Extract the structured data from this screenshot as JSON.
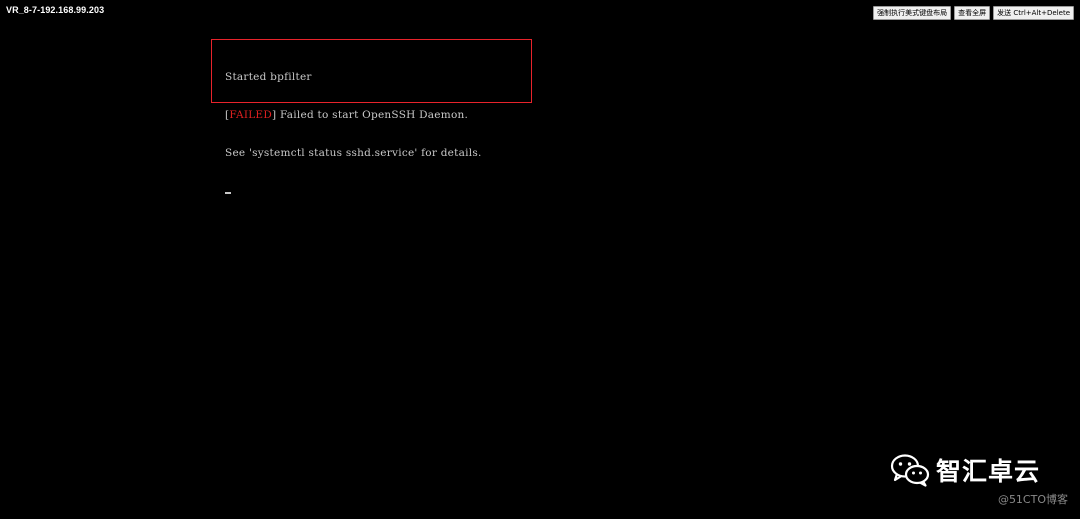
{
  "window": {
    "vm_title": "VR_8-7-192.168.99.203"
  },
  "toolbar": {
    "buttons": [
      {
        "label": "强制执行美式键盘布局"
      },
      {
        "label": "查看全屏"
      },
      {
        "label": "发送 Ctrl+Alt+Delete"
      }
    ]
  },
  "console": {
    "line1": "Started bpfilter",
    "line2_open": "[",
    "line2_status": "FAILED",
    "line2_close": "]",
    "line2_rest": " Failed to start OpenSSH Daemon.",
    "line3": "See 'systemctl status sshd.service' for details."
  },
  "colors": {
    "failed": "#e02020",
    "highlight_box": "#e8232b",
    "console_text": "#c8c8c8",
    "background": "#000000"
  },
  "watermark": {
    "icon": "wechat-icon",
    "title": "智汇卓云",
    "subtitle": "@51CTO博客"
  }
}
